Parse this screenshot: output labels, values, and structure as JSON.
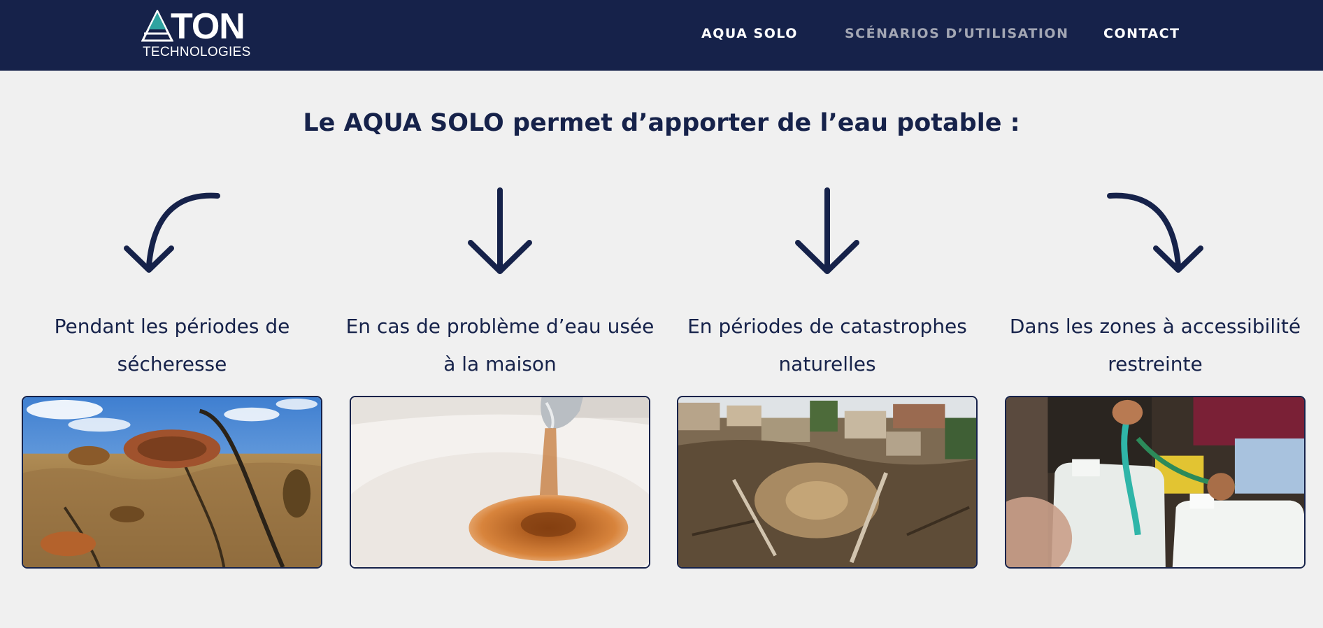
{
  "header": {
    "logo_word": "TON",
    "logo_sub": "TECHNOLOGIES",
    "nav": [
      {
        "label": "AQUA SOLO"
      },
      {
        "label": "SCÉNARIOS D’UTILISATION"
      },
      {
        "label": "CONTACT"
      }
    ]
  },
  "main": {
    "heading": "Le AQUA SOLO permet d’apporter de l’eau potable :",
    "scenarios": [
      {
        "caption": "Pendant les périodes de sécheresse",
        "arrow": "curved-arrow-down-left-icon"
      },
      {
        "caption": "En cas de problème d’eau usée à la maison",
        "arrow": "arrow-down-icon"
      },
      {
        "caption": "En périodes de catastrophes naturelles",
        "arrow": "arrow-down-icon"
      },
      {
        "caption": "Dans les zones à accessibilité restreinte",
        "arrow": "curved-arrow-down-right-icon"
      }
    ]
  },
  "colors": {
    "navy": "#16224a",
    "background": "#f0f0f0",
    "nav_muted": "#a3a7b4",
    "logo_accent": "#2fa3a0"
  }
}
